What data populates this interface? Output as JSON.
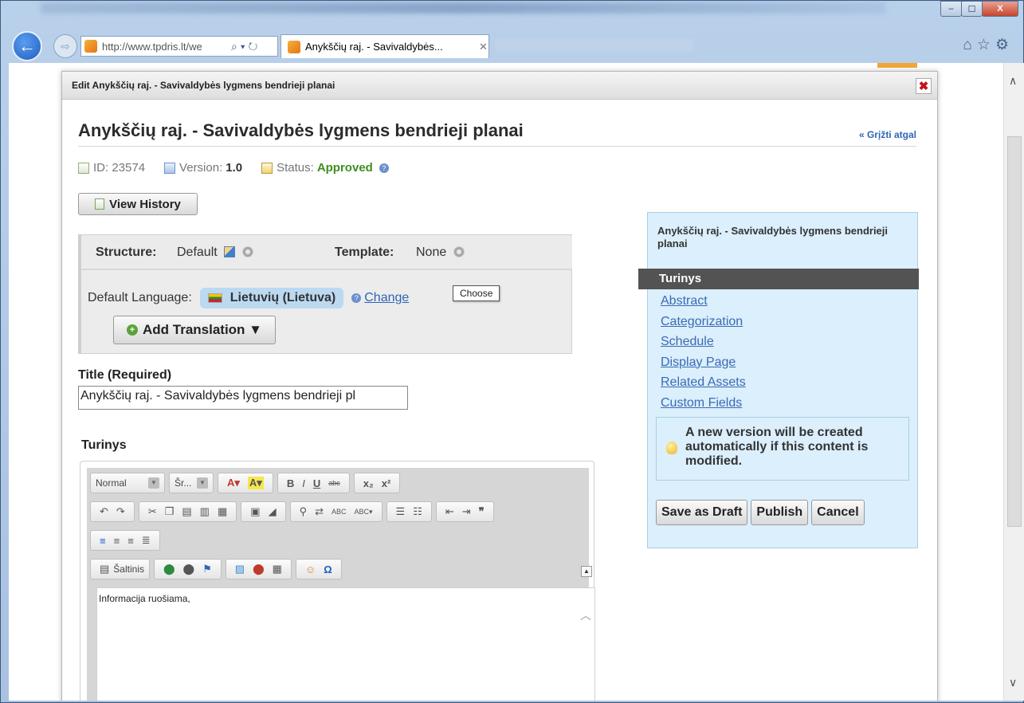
{
  "browser": {
    "url": "http://www.tpdris.lt/we",
    "tab_title": "Anykščių raj. - Savivaldybės...",
    "window_controls": {
      "minimize": "–",
      "maximize": "☐",
      "close": "X"
    }
  },
  "dialog": {
    "header_title": "Edit Anykščių raj. - Savivaldybės lygmens bendrieji planai",
    "page_title": "Anykščių raj. - Savivaldybės lygmens bendrieji planai",
    "back_link": "« Grįžti atgal",
    "meta": {
      "id_label": "ID: 23574",
      "version_label": "Version:",
      "version_value": "1.0",
      "status_label": "Status:",
      "status_value": "Approved"
    },
    "view_history_label": "View History",
    "structure_label": "Structure:",
    "structure_value": "Default",
    "template_label": "Template:",
    "template_value": "None",
    "default_language_label": "Default Language:",
    "default_language_value": "Lietuvių (Lietuva)",
    "change_link": "Change",
    "tooltip": "Choose",
    "add_translation_label": "Add Translation ▼",
    "title_label": "Title (Required)",
    "title_value": "Anykščių raj. - Savivaldybės lygmens bendrieji pl",
    "turinys_label": "Turinys",
    "editor": {
      "format_combo": "Normal",
      "font_combo": "Šr...",
      "source_label": "Šaltinis",
      "content": "Informacija ruošiama,"
    }
  },
  "side_panel": {
    "title": "Anykščių raj. - Savivaldybės lygmens bendrieji planai",
    "active_item": "Turinys",
    "links": [
      "Abstract",
      "Categorization",
      "Schedule",
      "Display Page",
      "Related Assets",
      "Custom Fields"
    ],
    "notice": "A new version will be created automatically if this content is modified.",
    "buttons": {
      "save_draft": "Save as Draft",
      "publish": "Publish",
      "cancel": "Cancel"
    }
  },
  "colors": {
    "approved_green": "#3d8f20",
    "link_blue": "#2f66b3",
    "panel_bg": "#dbeffc",
    "active_item_bg": "#535353"
  }
}
